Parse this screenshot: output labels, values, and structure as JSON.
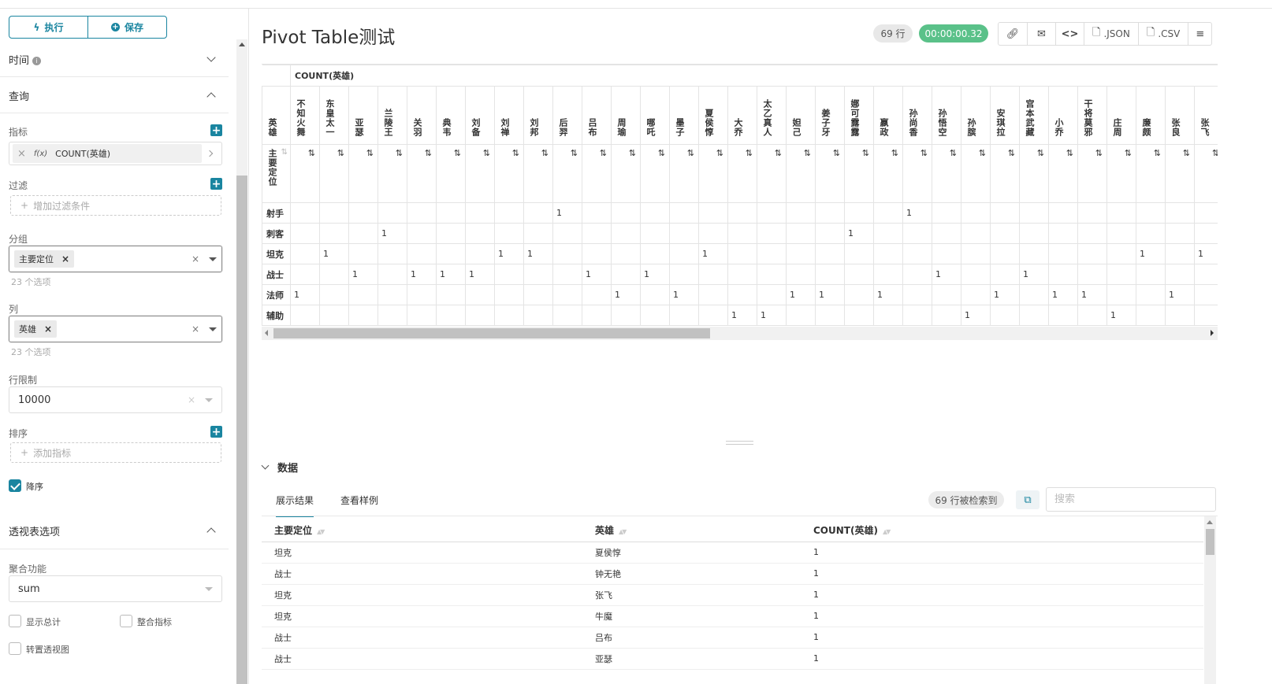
{
  "toolbar": {
    "run_label": "执行",
    "save_label": "保存"
  },
  "sections": {
    "time": "时间",
    "query": "查询",
    "pivot_options": "透视表选项"
  },
  "query": {
    "metrics_label": "指标",
    "metric_value": "COUNT(英雄)",
    "metric_fx": "f(x)",
    "filter_label": "过滤",
    "filter_placeholder": "增加过滤条件",
    "groupby_label": "分组",
    "groupby_tag": "主要定位",
    "groupby_hint": "23 个选项",
    "columns_label": "列",
    "columns_tag": "英雄",
    "columns_hint": "23 个选项",
    "row_limit_label": "行限制",
    "row_limit_value": "10000",
    "sort_label": "排序",
    "sort_placeholder": "添加指标",
    "descending_label": "降序"
  },
  "pivot_options": {
    "agg_label": "聚合功能",
    "agg_value": "sum",
    "show_totals": "显示总计",
    "combine_metrics": "整合指标",
    "transpose": "转置透视图"
  },
  "chart": {
    "title": "Pivot Table测试",
    "row_count": "69 行",
    "elapsed": "00:00:00.32",
    "json_label": ".JSON",
    "csv_label": ".CSV"
  },
  "pivot": {
    "metric_header": "COUNT(英雄)",
    "column_dim": "英雄",
    "row_dim": "主要定位",
    "columns": [
      "不知火舞",
      "东皇太一",
      "亚瑟",
      "兰陵王",
      "关羽",
      "典韦",
      "刘备",
      "刘禅",
      "刘邦",
      "后羿",
      "吕布",
      "周瑜",
      "哪吒",
      "墨子",
      "夏侯惇",
      "大乔",
      "太乙真人",
      "妲己",
      "姜子牙",
      "娜可露露",
      "嬴政",
      "孙尚香",
      "孙悟空",
      "孙膑",
      "安琪拉",
      "宫本武藏",
      "小乔",
      "干将莫邪",
      "庄周",
      "廉颇",
      "张良",
      "张飞"
    ],
    "rows": [
      {
        "label": "射手",
        "cells": [
          "",
          "",
          "",
          "",
          "",
          "",
          "",
          "",
          "",
          "1",
          "",
          "",
          "",
          "",
          "",
          "",
          "",
          "",
          "",
          "",
          "",
          "1",
          "",
          "",
          "",
          "",
          "",
          "",
          "",
          "",
          "",
          ""
        ]
      },
      {
        "label": "刺客",
        "cells": [
          "",
          "",
          "",
          "1",
          "",
          "",
          "",
          "",
          "",
          "",
          "",
          "",
          "",
          "",
          "",
          "",
          "",
          "",
          "",
          "1",
          "",
          "",
          "",
          "",
          "",
          "",
          "",
          "",
          "",
          "",
          "",
          ""
        ]
      },
      {
        "label": "坦克",
        "cells": [
          "",
          "1",
          "",
          "",
          "",
          "",
          "",
          "1",
          "1",
          "",
          "",
          "",
          "",
          "",
          "1",
          "",
          "",
          "",
          "",
          "",
          "",
          "",
          "",
          "",
          "",
          "",
          "",
          "",
          "",
          "1",
          "",
          "1"
        ]
      },
      {
        "label": "战士",
        "cells": [
          "",
          "",
          "1",
          "",
          "1",
          "1",
          "1",
          "",
          "",
          "",
          "1",
          "",
          "1",
          "",
          "",
          "",
          "",
          "",
          "",
          "",
          "",
          "",
          "1",
          "",
          "",
          "1",
          "",
          "",
          "",
          "",
          "",
          ""
        ]
      },
      {
        "label": "法师",
        "cells": [
          "1",
          "",
          "",
          "",
          "",
          "",
          "",
          "",
          "",
          "",
          "",
          "1",
          "",
          "1",
          "",
          "",
          "",
          "1",
          "1",
          "",
          "1",
          "",
          "",
          "",
          "1",
          "",
          "1",
          "1",
          "",
          "",
          "1",
          ""
        ]
      },
      {
        "label": "辅助",
        "cells": [
          "",
          "",
          "",
          "",
          "",
          "",
          "",
          "",
          "",
          "",
          "",
          "",
          "",
          "",
          "",
          "1",
          "1",
          "",
          "",
          "",
          "",
          "",
          "",
          "1",
          "",
          "",
          "",
          "",
          "1",
          "",
          "",
          ""
        ]
      }
    ]
  },
  "data_section": {
    "title": "数据",
    "tab_results": "展示结果",
    "tab_samples": "查看样例",
    "found": "69 行被检索到",
    "search_placeholder": "搜索",
    "columns": [
      "主要定位",
      "英雄",
      "COUNT(英雄)"
    ],
    "rows": [
      [
        "坦克",
        "夏侯惇",
        "1"
      ],
      [
        "战士",
        "钟无艳",
        "1"
      ],
      [
        "坦克",
        "张飞",
        "1"
      ],
      [
        "坦克",
        "牛魔",
        "1"
      ],
      [
        "战士",
        "吕布",
        "1"
      ],
      [
        "战士",
        "亚瑟",
        "1"
      ]
    ]
  }
}
